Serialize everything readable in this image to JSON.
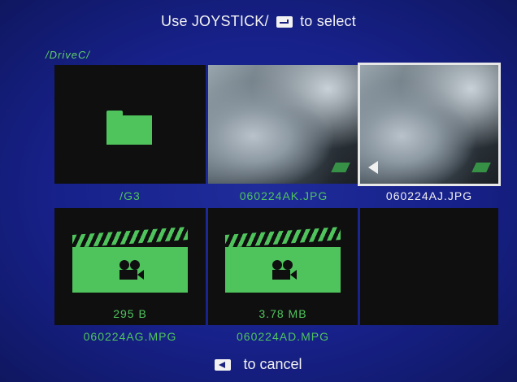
{
  "header": {
    "prefix": "Use JOYSTICK/",
    "suffix": "to select"
  },
  "path": "/DriveC/",
  "files": [
    {
      "name": "/G3",
      "type": "folder",
      "selected": false
    },
    {
      "name": "060224AK.JPG",
      "type": "image",
      "selected": false
    },
    {
      "name": "060224AJ.JPG",
      "type": "image",
      "selected": true
    },
    {
      "name": "060224AG.MPG",
      "type": "video",
      "size": "295 B",
      "selected": false
    },
    {
      "name": "060224AD.MPG",
      "type": "video",
      "size": "3.78 MB",
      "selected": false
    }
  ],
  "footer": {
    "label": "to cancel"
  },
  "colors": {
    "background": "#17218a",
    "accent": "#4fc45c",
    "text": "#f2f2f2"
  }
}
